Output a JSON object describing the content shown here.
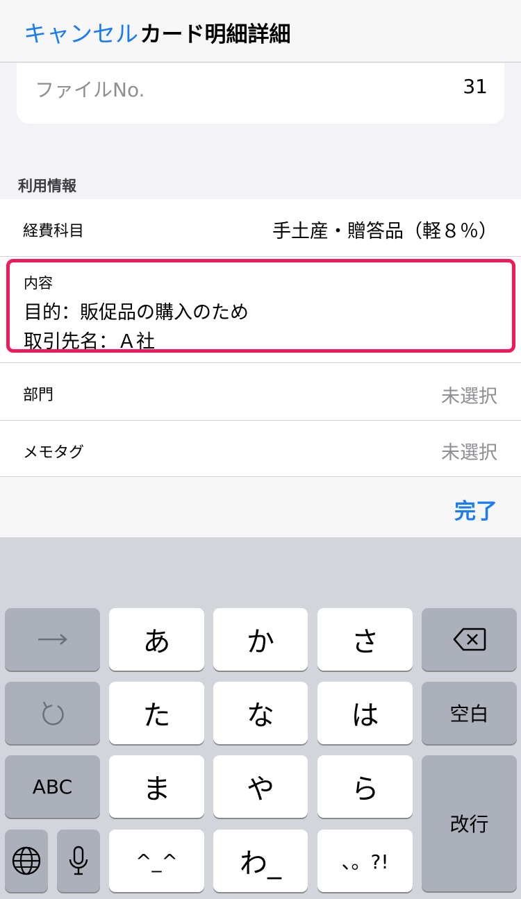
{
  "nav": {
    "cancel_label": "キャンセル",
    "title": "カード明細詳細"
  },
  "file": {
    "label": "ファイルNo.",
    "value": "31"
  },
  "section": {
    "header": "利用情報"
  },
  "rows": {
    "expense": {
      "label": "経費科目",
      "value": "手土産・贈答品（軽８％）"
    },
    "content": {
      "label": "内容",
      "line1": "目的：販促品の購入のため",
      "line2": "取引先名：Ａ社"
    },
    "department": {
      "label": "部門",
      "value": "未選択"
    },
    "memo_tag": {
      "label": "メモタグ",
      "value": "未選択"
    }
  },
  "toolbar": {
    "done_label": "完了"
  },
  "keyboard": {
    "keys": {
      "a": "あ",
      "ka": "か",
      "sa": "さ",
      "ta": "た",
      "na": "な",
      "ha": "は",
      "ma": "ま",
      "ya": "や",
      "ra": "ら",
      "emoticon": "^_^",
      "wa": "わ_",
      "punct": "、。?!",
      "abc": "ABC",
      "space": "空白",
      "return": "改行"
    }
  },
  "colors": {
    "accent": "#1a7cf5",
    "highlight": "#ee1a5c"
  }
}
